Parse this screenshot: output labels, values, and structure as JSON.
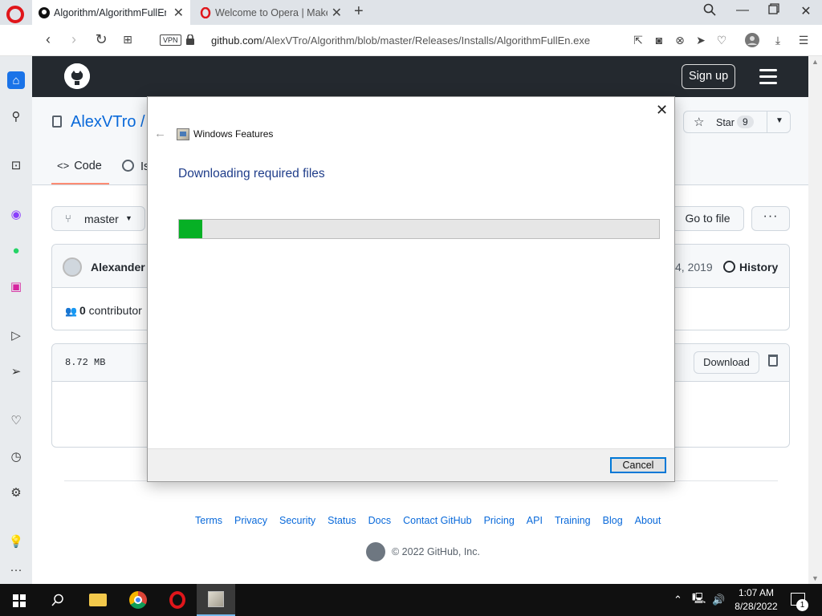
{
  "browser": {
    "tabs": [
      {
        "title": "Algorithm/AlgorithmFullEn",
        "active": true
      },
      {
        "title": "Welcome to Opera | Make",
        "active": false
      }
    ],
    "url_host": "github.com",
    "url_path": "/AlexVTro/Algorithm/blob/master/Releases/Installs/AlgorithmFullEn.exe",
    "vpn_label": "VPN"
  },
  "github": {
    "signup_label": "Sign up",
    "repo_owner": "AlexVTro / .",
    "star_label": "Star",
    "star_count": "9",
    "tabs": {
      "code": "Code",
      "issues": "Is"
    },
    "branch": "master",
    "goto_file": "Go to file",
    "more": "···",
    "commit": {
      "author": "Alexander T",
      "date": "4, 2019",
      "history": "History",
      "contributors_count": "0",
      "contributors_label": "contributor"
    },
    "file": {
      "size": "8.72 MB",
      "download": "Download"
    },
    "footer": {
      "links": [
        "Terms",
        "Privacy",
        "Security",
        "Status",
        "Docs",
        "Contact GitHub",
        "Pricing",
        "API",
        "Training",
        "Blog",
        "About"
      ],
      "copyright": "© 2022 GitHub, Inc."
    }
  },
  "dialog": {
    "app_title": "Windows Features",
    "heading": "Downloading required files",
    "progress": 0.048,
    "progress_color": "#06b025",
    "cancel": "Cancel"
  },
  "taskbar": {
    "time": "1:07 AM",
    "date": "8/28/2022",
    "notifications": "1"
  }
}
